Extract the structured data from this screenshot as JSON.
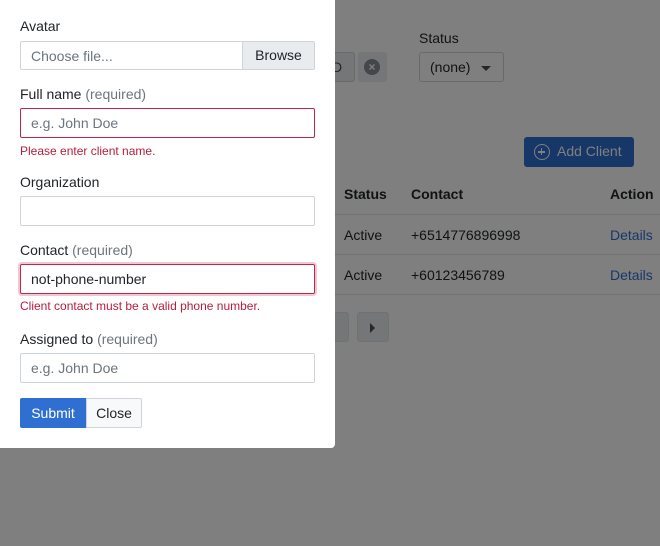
{
  "background": {
    "filters": {
      "chip_text": "D",
      "status_label": "Status",
      "status_value": "(none)"
    },
    "add_client_label": "Add Client",
    "table": {
      "headers": [
        "Status",
        "Contact",
        "Action"
      ],
      "rows": [
        {
          "status": "Active",
          "contact": "+6514776896998",
          "action": "Details"
        },
        {
          "status": "Active",
          "contact": "+60123456789",
          "action": "Details"
        }
      ]
    }
  },
  "modal": {
    "avatar": {
      "label": "Avatar",
      "file_placeholder": "Choose file...",
      "browse_label": "Browse"
    },
    "full_name": {
      "label": "Full name",
      "required": "(required)",
      "placeholder": "e.g. John Doe",
      "value": "",
      "error": "Please enter client name."
    },
    "organization": {
      "label": "Organization",
      "value": ""
    },
    "contact": {
      "label": "Contact",
      "required": "(required)",
      "value": "not-phone-number",
      "error": "Client contact must be a valid phone number."
    },
    "assigned_to": {
      "label": "Assigned to",
      "required": "(required)",
      "placeholder": "e.g. John Doe",
      "value": ""
    },
    "submit_label": "Submit",
    "close_label": "Close"
  },
  "colors": {
    "primary": "#2f6fd1",
    "error": "#b71c3c",
    "overlay": "rgba(0,0,0,0.5)"
  }
}
